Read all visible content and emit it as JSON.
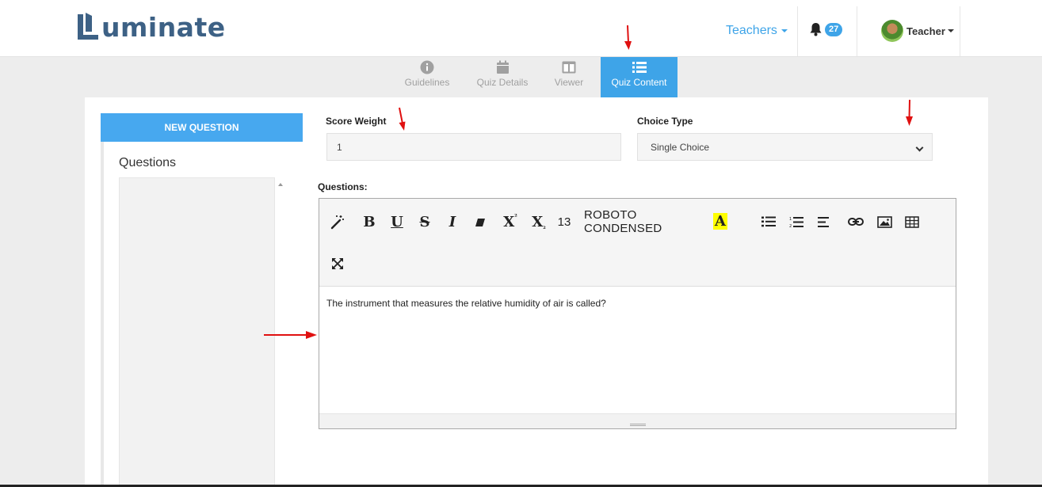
{
  "brand": {
    "logo_text": "uminate",
    "logo_full": "Luminate"
  },
  "nav": {
    "teachers_label": "Teachers",
    "notifications_count": "27",
    "user_label": "Teacher"
  },
  "tabs": [
    {
      "label": "Guidelines",
      "icon": "info-circle-icon"
    },
    {
      "label": "Quiz Details",
      "icon": "calendar-icon"
    },
    {
      "label": "Viewer",
      "icon": "columns-icon"
    },
    {
      "label": "Quiz Content",
      "icon": "list-icon",
      "active": true
    }
  ],
  "sidebar": {
    "new_question_label": "NEW QUESTION",
    "questions_title": "Questions"
  },
  "form": {
    "score_weight_label": "Score Weight",
    "score_weight_value": "1",
    "choice_type_label": "Choice Type",
    "choice_type_value": "Single Choice",
    "questions_label": "Questions:"
  },
  "editor": {
    "font_size": "13",
    "font_family": "ROBOTO CONDENSED",
    "content": "The instrument that measures the relative humidity of air is called?"
  },
  "colors": {
    "accent": "#3ea4e8",
    "brand": "#3d6185",
    "annotation_arrow": "#e01010",
    "highlight": "#ffff00"
  }
}
